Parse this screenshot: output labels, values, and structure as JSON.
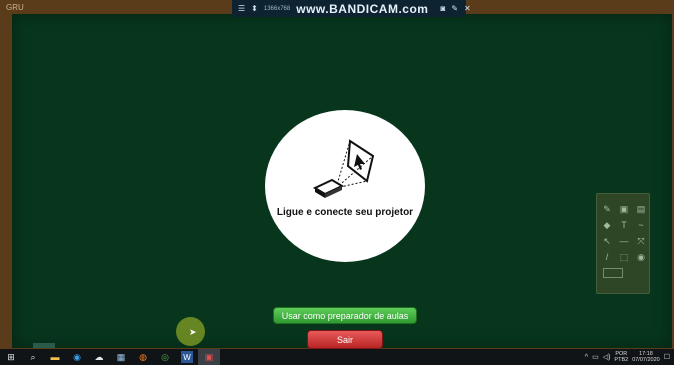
{
  "window": {
    "corner_label": "GRU"
  },
  "recorder": {
    "resolution": "1366x768",
    "brand": "www.BANDICAM.com",
    "icons": [
      "menu-icon",
      "pin-icon",
      "record-dot-icon",
      "camera-icon",
      "pencil-icon",
      "close-icon"
    ]
  },
  "splash": {
    "message": "Ligue e conecte seu projetor",
    "icon": "projector-icon"
  },
  "buttons": {
    "prepare": "Usar como preparador de aulas",
    "exit": "Sair"
  },
  "colors": {
    "board": "#07361d",
    "frame": "#5a3c1a",
    "green_button": "#3fae3c",
    "red_button": "#c93333"
  },
  "toolbar": {
    "icons": [
      "paint-icon",
      "image-icon",
      "save-icon",
      "eraser-icon",
      "text-icon",
      "shape-icon",
      "pointer-icon",
      "line-icon",
      "move-icon",
      "pen-icon",
      "select-icon",
      "fill-icon",
      "screen-icon"
    ],
    "glyphs": [
      "✎",
      "▣",
      "▤",
      "◆",
      "T",
      "~",
      "↖",
      "—",
      "⤧",
      "/",
      "⬚",
      "◉"
    ]
  },
  "taskbar": {
    "apps": [
      "windows-start-icon",
      "search-icon",
      "file-explorer-icon",
      "edge-icon",
      "paint-icon",
      "calculator-icon",
      "firefox-icon",
      "chrome-icon",
      "word-icon",
      "whiteboard-app-icon"
    ],
    "glyphs": [
      "⊞",
      "⌕",
      "▬",
      "◉",
      "☁",
      "▦",
      "◍",
      "◎",
      "W",
      "▣"
    ],
    "language": "POR",
    "layout": "PTB2",
    "time": "17:18",
    "date": "07/07/2020",
    "tray_glyphs": [
      "^",
      "▭",
      "◁)",
      "☐"
    ]
  }
}
